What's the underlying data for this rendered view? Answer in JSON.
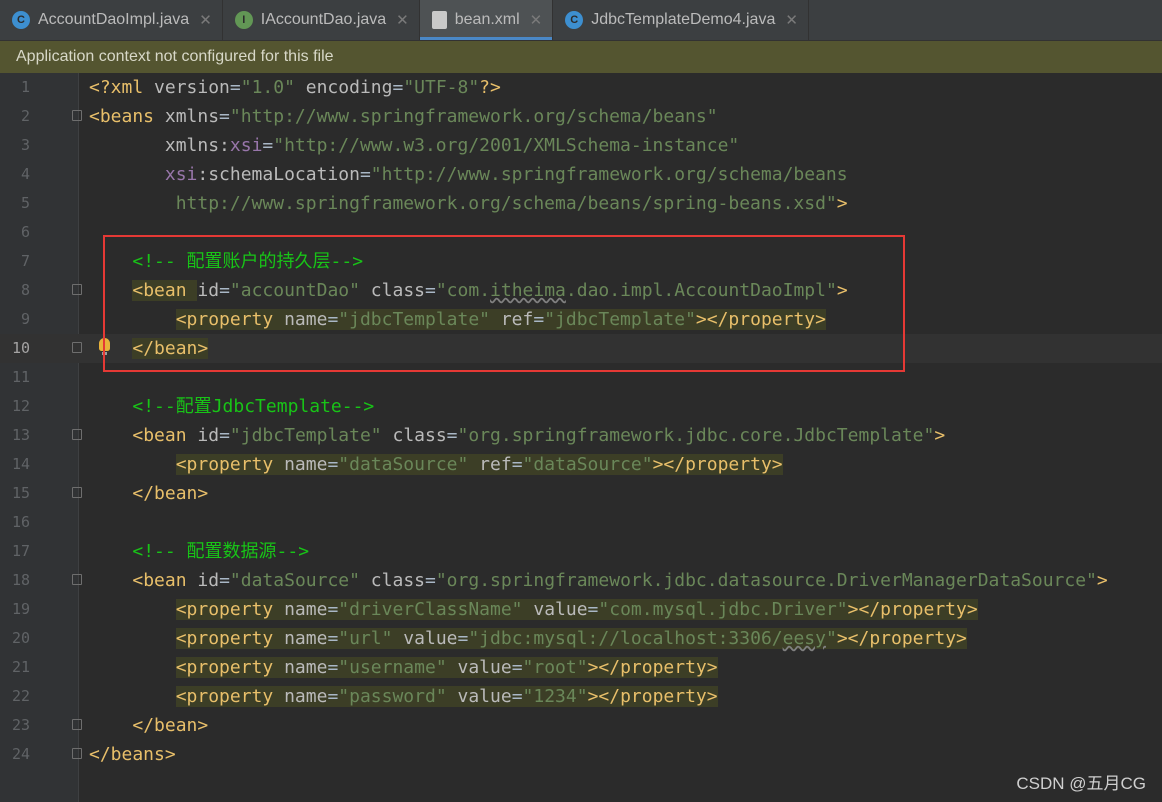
{
  "tabs": [
    {
      "label": "AccountDaoImpl.java",
      "icon": "class-icon",
      "active": false
    },
    {
      "label": "IAccountDao.java",
      "icon": "interface-icon",
      "active": false
    },
    {
      "label": "bean.xml",
      "icon": "xml-file-icon",
      "active": true
    },
    {
      "label": "JdbcTemplateDemo4.java",
      "icon": "class-icon",
      "active": false
    }
  ],
  "notice": "Application context not configured for this file",
  "current_line": 10,
  "lines": [
    {
      "n": "1"
    },
    {
      "n": "2"
    },
    {
      "n": "3"
    },
    {
      "n": "4"
    },
    {
      "n": "5"
    },
    {
      "n": "6"
    },
    {
      "n": "7"
    },
    {
      "n": "8"
    },
    {
      "n": "9"
    },
    {
      "n": "10"
    },
    {
      "n": "11"
    },
    {
      "n": "12"
    },
    {
      "n": "13"
    },
    {
      "n": "14"
    },
    {
      "n": "15"
    },
    {
      "n": "16"
    },
    {
      "n": "17"
    },
    {
      "n": "18"
    },
    {
      "n": "19"
    },
    {
      "n": "20"
    },
    {
      "n": "21"
    },
    {
      "n": "22"
    },
    {
      "n": "23"
    },
    {
      "n": "24"
    }
  ],
  "code": {
    "l1": {
      "decl": "<?xml ",
      "a1": "version",
      "v1": "\"1.0\"",
      "a2": " encoding",
      "v2": "\"UTF-8\"",
      "end": "?>"
    },
    "l2": {
      "open": "<beans ",
      "a": "xmlns",
      "v": "\"http://www.springframework.org/schema/beans\""
    },
    "l3": {
      "ns": "xmlns:",
      "xsi": "xsi",
      "v": "\"http://www.w3.org/2001/XMLSchema-instance\""
    },
    "l4": {
      "xsi": "xsi",
      "a": ":schemaLocation",
      "v": "\"http://www.springframework.org/schema/beans"
    },
    "l5": {
      "v": "http://www.springframework.org/schema/beans/spring-beans.xsd\"",
      "end": ">"
    },
    "l7": {
      "c": "<!-- 配置账户的持久层-->"
    },
    "l8": {
      "open": "<bean ",
      "a1": "id",
      "v1": "\"accountDao\"",
      "a2": " class",
      "v2a": "\"com.",
      "v2b": "itheima",
      "v2c": ".dao.impl.AccountDaoImpl\"",
      "end": ">"
    },
    "l9": {
      "open": "<property ",
      "a1": "name",
      "v1": "\"jdbcTemplate\"",
      "a2": " ref",
      "v2": "\"jdbcTemplate\"",
      "end": "></property>"
    },
    "l10": {
      "t": "</bean>"
    },
    "l12": {
      "c": "<!--配置JdbcTemplate-->"
    },
    "l13": {
      "open": "<bean ",
      "a1": "id",
      "v1": "\"jdbcTemplate\"",
      "a2": " class",
      "v2": "\"org.springframework.jdbc.core.JdbcTemplate\"",
      "end": ">"
    },
    "l14": {
      "open": "<property ",
      "a1": "name",
      "v1": "\"dataSource\"",
      "a2": " ref",
      "v2": "\"dataSource\"",
      "end": "></property>"
    },
    "l15": {
      "t": "</bean>"
    },
    "l17": {
      "c": "<!-- 配置数据源-->"
    },
    "l18": {
      "open": "<bean ",
      "a1": "id",
      "v1": "\"dataSource\"",
      "a2": " class",
      "v2": "\"org.springframework.jdbc.datasource.DriverManagerDataSource\"",
      "end": ">"
    },
    "l19": {
      "open": "<property ",
      "a1": "name",
      "v1": "\"driverClassName\"",
      "a2": " value",
      "v2": "\"com.mysql.jdbc.Driver\"",
      "end": "></property>"
    },
    "l20": {
      "open": "<property ",
      "a1": "name",
      "v1": "\"url\"",
      "a2": " value",
      "v2a": "\"jdbc:mysql://localhost:3306/",
      "v2b": "eesy",
      "v2c": "\"",
      "end": "></property>"
    },
    "l21": {
      "open": "<property ",
      "a1": "name",
      "v1": "\"username\"",
      "a2": " value",
      "v2": "\"root\"",
      "end": "></property>"
    },
    "l22": {
      "open": "<property ",
      "a1": "name",
      "v1": "\"password\"",
      "a2": " value",
      "v2": "\"1234\"",
      "end": "></property>"
    },
    "l23": {
      "t": "</bean>"
    },
    "l24": {
      "t": "</beans>"
    }
  },
  "eq": "=",
  "watermark": "CSDN @五月CG",
  "colors": {
    "tag": "#e8bf6a",
    "value": "#6a8759",
    "comment": "#18c417",
    "namespace": "#9876aa",
    "highlight_box": "#e53935"
  }
}
